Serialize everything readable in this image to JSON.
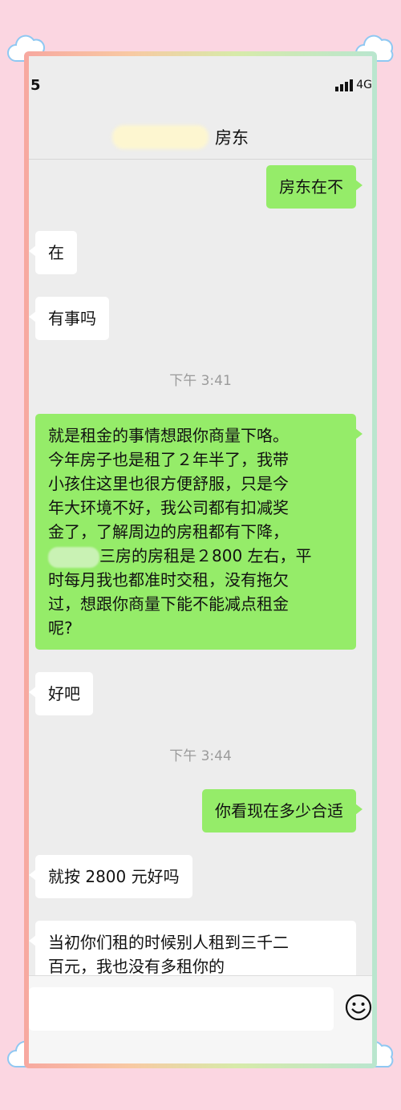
{
  "status": {
    "time": "5",
    "network": "4G"
  },
  "header": {
    "title": "房东"
  },
  "messages": [
    {
      "side": "out",
      "text": "房东在不"
    },
    {
      "side": "in",
      "text": "在"
    },
    {
      "side": "in",
      "text": "有事吗"
    },
    {
      "time": "下午 3:41"
    },
    {
      "side": "out",
      "text_lines": [
        "就是租金的事情想跟你商量下咯。",
        "今年房子也是租了２年半了，我带",
        "小孩住这里也很方便舒服，只是今",
        "年大环境不好，我公司都有扣减奖",
        "金了，了解周边的房租都有下降，",
        "三房的房租是２800 左右，平",
        "时每月我也都准时交租，没有拖欠",
        "过，想跟你商量下能不能减点租金",
        "呢?"
      ]
    },
    {
      "side": "in",
      "text": "好吧"
    },
    {
      "time": "下午 3:44"
    },
    {
      "side": "out",
      "text": "你看现在多少合适"
    },
    {
      "side": "in",
      "text": "就按 2800 元好吗"
    },
    {
      "side": "in",
      "text_lines": [
        "当初你们租的时候别人租到三千二",
        "百元，我也没有多租你的"
      ]
    }
  ],
  "icons": {
    "emoji": "smiley-icon",
    "cloud": "cloud-icon",
    "signal": "signal-icon"
  },
  "colors": {
    "outgoing": "#95ec69",
    "incoming": "#ffffff",
    "background": "#ededed",
    "page": "#fbd6e1"
  }
}
